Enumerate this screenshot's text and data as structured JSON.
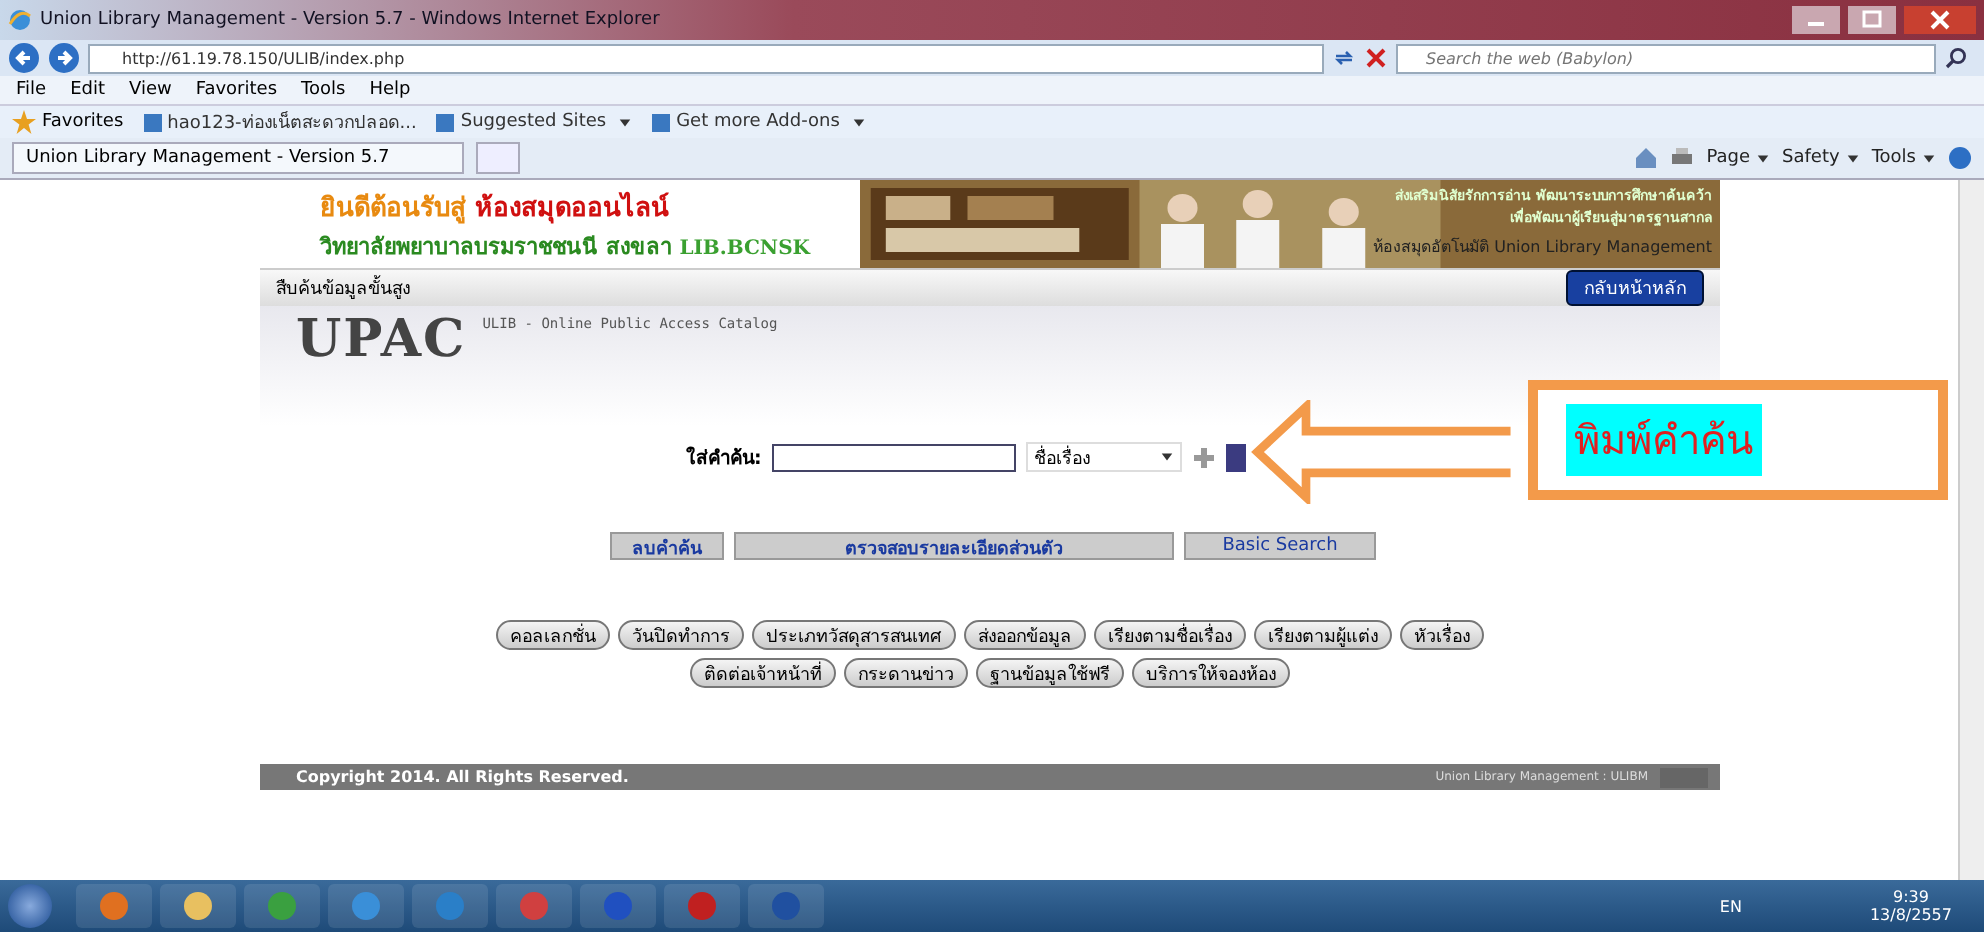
{
  "window": {
    "title": "Union Library Management - Version 5.7 - Windows Internet Explorer"
  },
  "address_bar": {
    "url": "http://61.19.78.150/ULIB/index.php",
    "search_placeholder": "Search the web (Babylon)"
  },
  "menu": [
    "File",
    "Edit",
    "View",
    "Favorites",
    "Tools",
    "Help"
  ],
  "favorites_bar": {
    "label": "Favorites",
    "links": [
      {
        "label": "hao123-ท่องเน็ตสะดวกปลอด...",
        "dropdown": false
      },
      {
        "label": "Suggested Sites",
        "dropdown": true
      },
      {
        "label": "Get more Add-ons",
        "dropdown": true
      }
    ]
  },
  "tab": {
    "title": "Union Library Management - Version 5.7"
  },
  "command_bar": [
    "Page",
    "Safety",
    "Tools"
  ],
  "banner": {
    "welcome": "ยินดีต้อนรับสู่",
    "library": "ห้องสมุดออนไลน์",
    "college": "วิทยาลัยพยาบาลบรมราชชนนี สงขลา",
    "code": "LIB.BCNSK",
    "slogan_1": "ส่งเสริมนิสัยรักการอ่าน พัฒนาระบบการศึกษาค้นคว้า",
    "slogan_2": "เพื่อพัฒนาผู้เรียนสู่มาตรฐานสากล",
    "system": "ห้องสมุดอัตโนมัติ Union Library Management"
  },
  "nav": {
    "title": "สืบค้นข้อมูลขั้นสูง",
    "home_button": "กลับหน้าหลัก"
  },
  "upac": {
    "logo": "UPAC",
    "subtitle": "ULIB - Online Public Access Catalog"
  },
  "search": {
    "label": "ใส่คำค้น:",
    "field": "ชื่อเรื่อง"
  },
  "actions": [
    "ลบคำค้น",
    "ตรวจสอบรายละเอียดส่วนตัว",
    "Basic Search"
  ],
  "links": [
    [
      "คอลเลกชั่น",
      "วันปิดทำการ",
      "ประเภทวัสดุสารสนเทศ",
      "ส่งออกข้อมูล",
      "เรียงตามชื่อเรื่อง",
      "เรียงตามผู้แต่ง",
      "หัวเรื่อง"
    ],
    [
      "ติดต่อเจ้าหน้าที่",
      "กระดานข่าว",
      "ฐานข้อมูลใช้ฟรี",
      "บริการให้จองห้อง"
    ]
  ],
  "footer": {
    "copyright": "Copyright 2014. All Rights Reserved.",
    "credit": "Union Library Management : ULIBM"
  },
  "callout": {
    "text": "พิมพ์คำค้น"
  },
  "taskbar": {
    "language": "EN",
    "time": "9:39",
    "date": "13/8/2557"
  }
}
